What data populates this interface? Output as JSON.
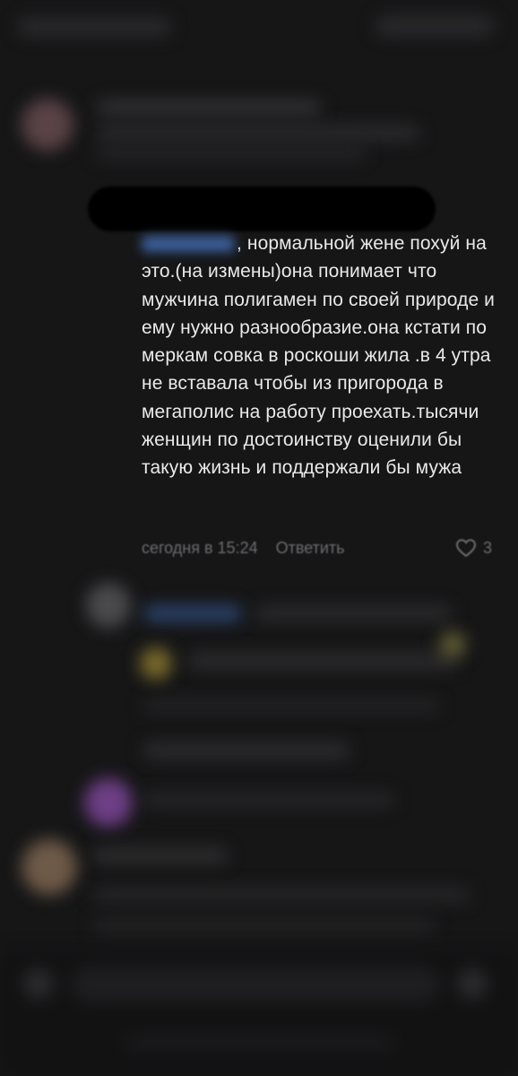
{
  "comment": {
    "mention_label": "",
    "text": ", нормальной жене похуй на это.(на измены)она понимает что мужчина полигамен по своей природе и ему нужно разнообразие.она кстати по меркам совка в роскоши жила .в 4 утра не вставала чтобы из пригорода в мегаполис на работу проехать.тысячи женщин по достоинству оценили бы такую жизнь и поддержали бы мужа",
    "timestamp": "сегодня в 15:24",
    "reply_label": "Ответить",
    "like_count": "3"
  },
  "icons": {
    "like": "heart-outline-icon"
  },
  "colors": {
    "background": "#161617",
    "text": "#e9e9e9",
    "meta": "#6d6d70",
    "mention": "#3b5f9a"
  }
}
